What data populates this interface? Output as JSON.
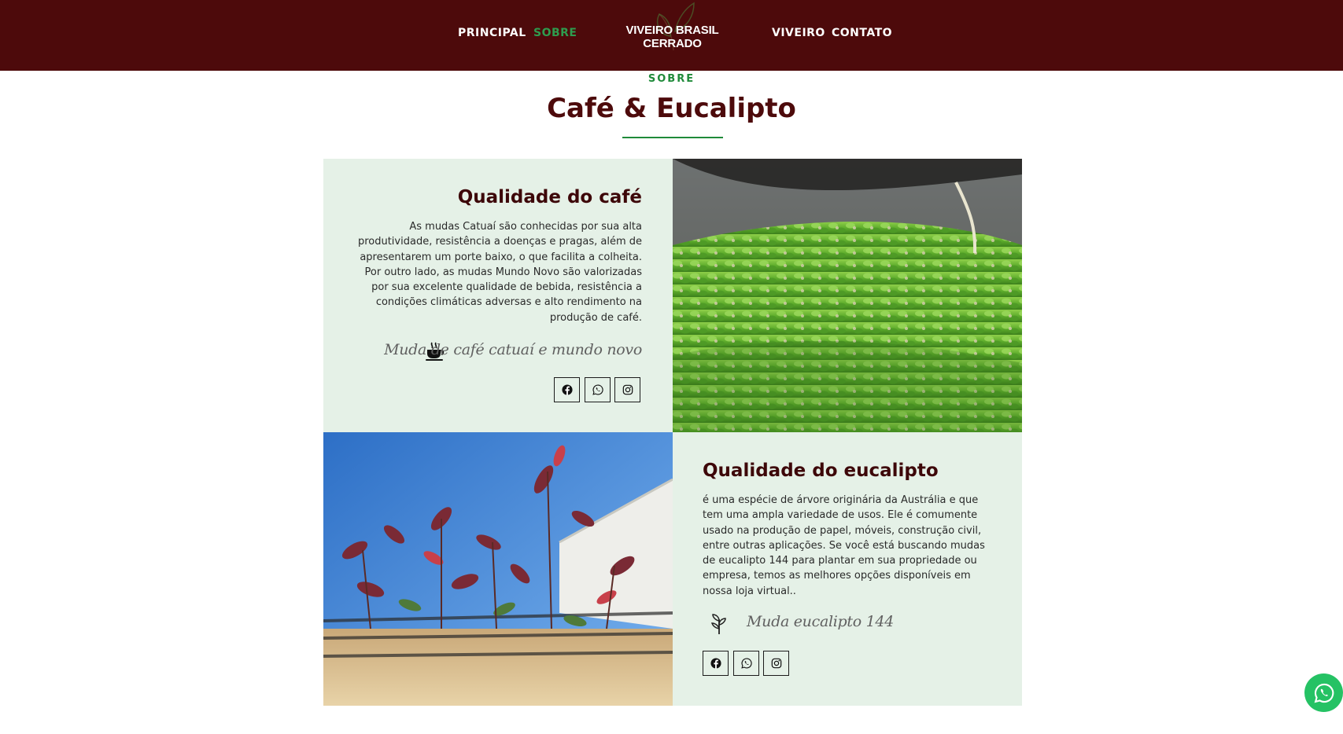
{
  "header": {
    "nav_left": [
      "PRINCIPAL",
      "SOBRE"
    ],
    "nav_right": [
      "VIVEIRO",
      "CONTATO"
    ],
    "active": "SOBRE",
    "logo_text": "VIVEIRO BRASIL CERRADO"
  },
  "section": {
    "eyebrow": "SOBRE",
    "title": "Café & Eucalipto"
  },
  "coffee": {
    "title": "Qualidade do café",
    "text_lines": [
      "As mudas Catuaí são conhecidas por sua alta",
      "produtividade, resistência a doenças e pragas, além de",
      "apresentarem um porte baixo, o que facilita a colheita.",
      "Por outro lado, as mudas Mundo Novo são valorizadas",
      "por sua excelente qualidade de bebida, resistência a",
      "condições climáticas adversas e alto rendimento na",
      "produção de café."
    ],
    "tagline": "Muda de café catuaí e mundo novo",
    "icon": "coffee-cup-icon",
    "photo": "coffee-seedlings-nursery-photo"
  },
  "eucalyptus": {
    "title": "Qualidade do eucalipto",
    "text_lines": [
      "é uma espécie de árvore originária da Austrália e que",
      "tem uma ampla variedade de usos. Ele é comumente",
      "usado na produção de papel, móveis, construção civil,",
      "entre outras aplicações. Se você está buscando mudas",
      "de eucalipto 144 para plantar em sua propriedade ou",
      "empresa, temos as melhores opções disponíveis em",
      "nossa loja virtual.."
    ],
    "tagline": "Muda eucalipto 144",
    "icon": "seedling-icon",
    "photo": "eucalyptus-seedlings-photo"
  },
  "social_icons": [
    "facebook-icon",
    "whatsapp-icon",
    "instagram-icon"
  ],
  "colors": {
    "header_bg": "#4d0a0b",
    "accent_green": "#1f8a3a",
    "panel_bg": "#e5f1e7",
    "title_color": "#4d0a0b",
    "whatsapp_float": "#25c264"
  }
}
